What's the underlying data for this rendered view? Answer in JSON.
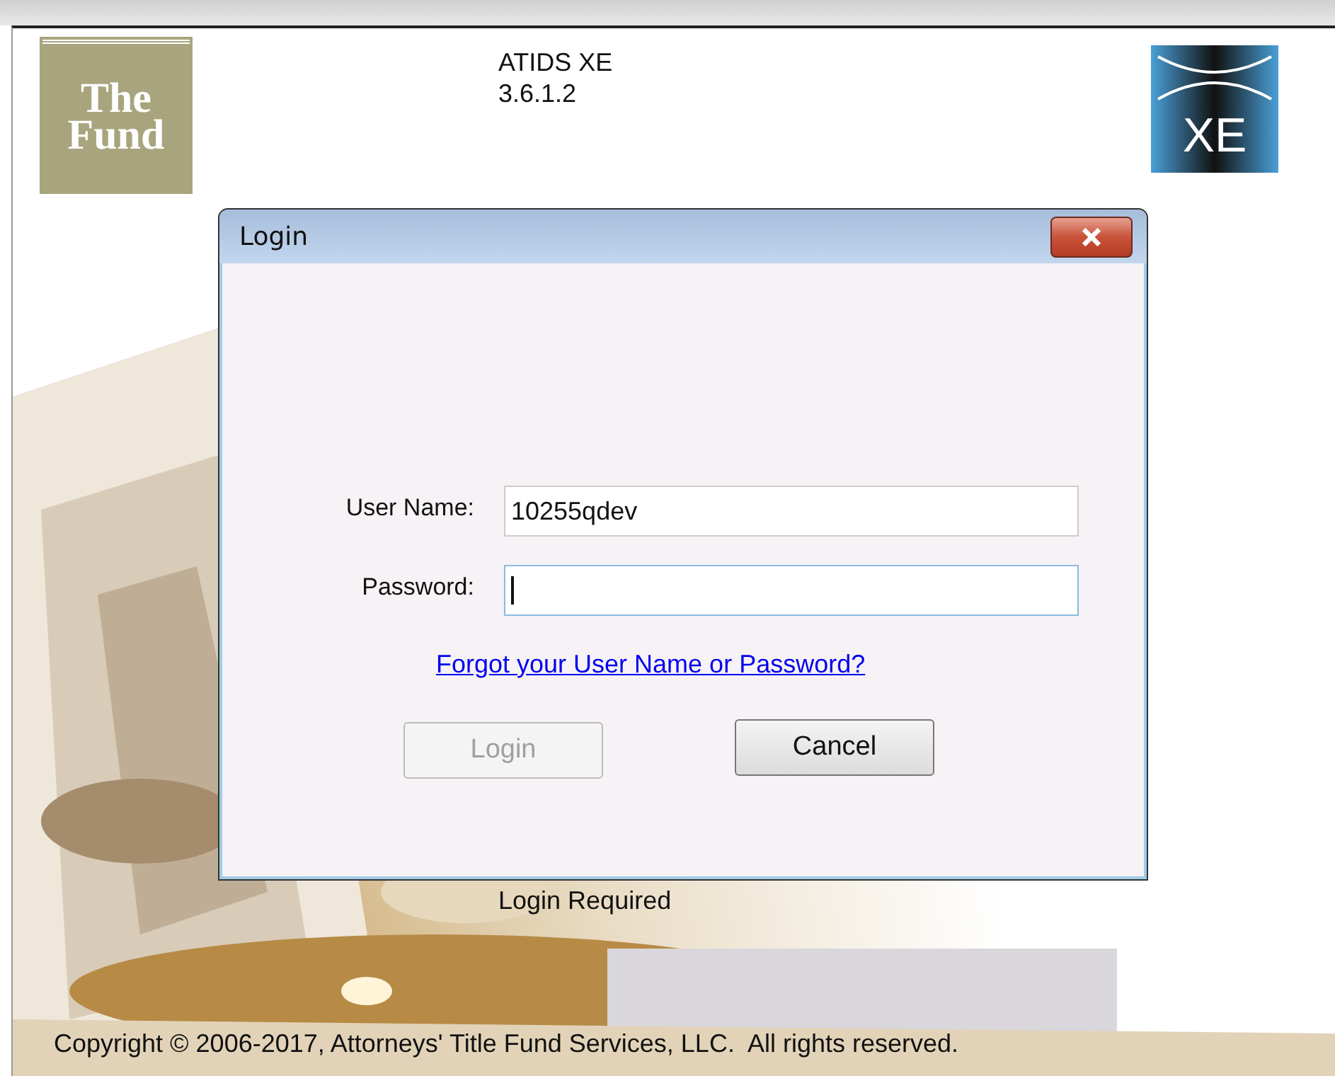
{
  "splash": {
    "logo_text": [
      "The",
      "Fund"
    ],
    "product": "ATIDS XE",
    "version": "3.6.1.2",
    "badge_text": "XE",
    "status": "Login Required",
    "copyright": "Copyright © 2006-2017, Attorneys' Title Fund Services, LLC.  All rights reserved."
  },
  "dialog": {
    "title": "Login",
    "fields": [
      {
        "label": "User Name:",
        "value": "10255qdev",
        "focused": false
      },
      {
        "label": "Password:",
        "focused": true
      }
    ],
    "link": "Forgot your User Name or Password?",
    "buttons": [
      {
        "label": "Login",
        "disabled": true
      },
      {
        "label": "Cancel",
        "disabled": false
      }
    ]
  }
}
